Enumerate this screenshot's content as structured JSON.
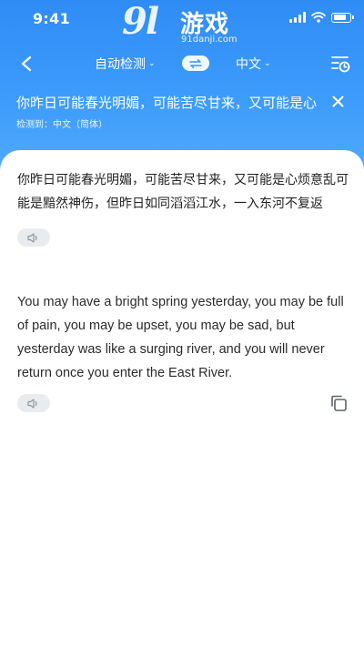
{
  "status": {
    "time": "9:41",
    "battery_level": 0.85
  },
  "watermark": {
    "logo": "9l",
    "brand": "游戏",
    "url": "91danji.com"
  },
  "nav": {
    "back_icon": "back-arrow-icon",
    "source_lang": "自动检测",
    "swap_icon": "swap-arrows-icon",
    "target_lang": "中文",
    "history_icon": "history-clock-icon"
  },
  "source": {
    "text": "你昨日可能春光明媚，可能苦尽甘来，又可能是心烦意乱可能是黯然神伤",
    "detected_label": "检测到：中文（简体）",
    "close_icon": "close-icon"
  },
  "content": {
    "original": "你昨日可能春光明媚，可能苦尽甘来，又可能是心烦意乱可能是黯然神伤，但昨日如同滔滔江水，一入东河不复返",
    "translation": "You may have a bright spring yesterday, you may be full of pain, you may be upset, you may be sad, but yesterday was like a surging river, and you will never return once you enter the East River.",
    "speaker_icon": "speaker-icon",
    "copy_icon": "copy-icon"
  },
  "colors": {
    "header_top": "#2f8cf6",
    "header_bottom": "#52acff",
    "pill_bg": "#e9ecef"
  }
}
